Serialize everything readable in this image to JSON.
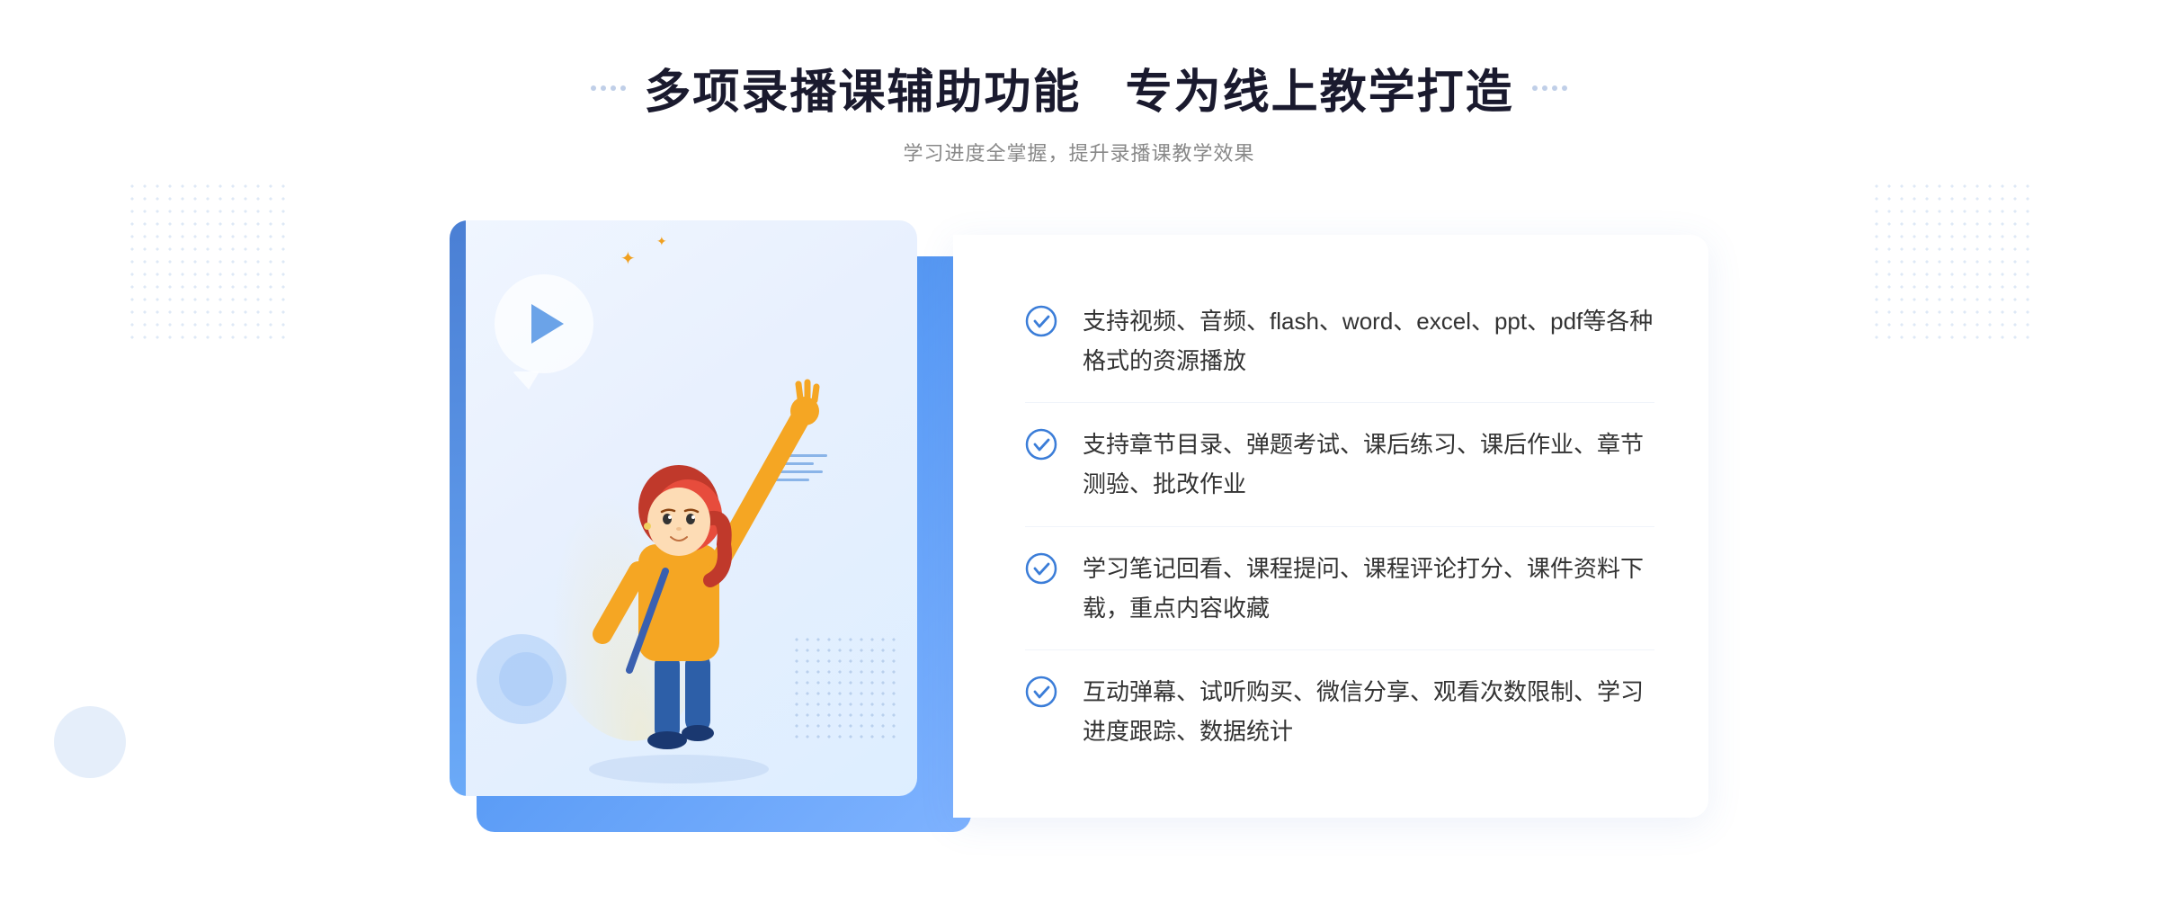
{
  "header": {
    "title_part1": "多项录播课辅助功能",
    "title_part2": "专为线上教学打造",
    "subtitle": "学习进度全掌握，提升录播课教学效果",
    "title_full": "多项录播课辅助功能 专为线上教学打造"
  },
  "features": [
    {
      "id": 1,
      "text": "支持视频、音频、flash、word、excel、ppt、pdf等各种格式的资源播放"
    },
    {
      "id": 2,
      "text": "支持章节目录、弹题考试、课后练习、课后作业、章节测验、批改作业"
    },
    {
      "id": 3,
      "text": "学习笔记回看、课程提问、课程评论打分、课件资料下载，重点内容收藏"
    },
    {
      "id": 4,
      "text": "互动弹幕、试听购买、微信分享、观看次数限制、学习进度跟踪、数据统计"
    }
  ],
  "icons": {
    "check": "check-circle-icon",
    "play": "play-icon",
    "arrows_left": "chevron-left-icon"
  },
  "colors": {
    "primary": "#3b7dd8",
    "accent": "#5b9cf6",
    "text_dark": "#1a1a2e",
    "text_main": "#333333",
    "text_sub": "#888888",
    "check_color": "#3b7dd8"
  }
}
